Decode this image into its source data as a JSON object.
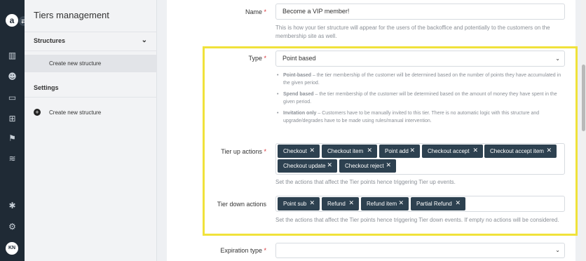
{
  "rail": {
    "logo": "a",
    "toggle": "⇄",
    "icons": [
      "chart-icon",
      "users-icon",
      "wallet-icon",
      "gift-icon",
      "flag-icon",
      "waves-icon",
      "puzzle-icon",
      "gear-icon"
    ],
    "avatar": "KN"
  },
  "sidebar": {
    "title": "Tiers management",
    "structures_label": "Structures",
    "create_sub": "Create new structure",
    "settings_label": "Settings",
    "create_action": "Create new structure"
  },
  "form": {
    "name_label": "Name",
    "name_value": "Become a VIP member!",
    "name_help": "This is how your tier structure will appear for the users of the backoffice and potentially to the customers on the membership site as well.",
    "type_label": "Type",
    "type_value": "Point based",
    "type_help": [
      {
        "term": "Point-based",
        "text": " – the tier membership of the customer will be determined based on the number of points they have accumulated in the given period."
      },
      {
        "term": "Spend based",
        "text": " – the tier membership of the customer will be determined based on the amount of money they have spent in the given period."
      },
      {
        "term": "Invitation only",
        "text": " – Customers have to be manually invited to this tier. There is no automatic logic with this structure and upgrade/degrades have to be made using rules/manual intervention."
      }
    ],
    "tier_up_label": "Tier up actions",
    "tier_up_tags": [
      "Checkout",
      "Checkout item",
      "Point add",
      "Checkout accept",
      "Checkout accept item",
      "Checkout update",
      "Checkout reject"
    ],
    "tier_up_help": "Set the actions that affect the Tier points hence triggering Tier up events.",
    "tier_down_label": "Tier down actions",
    "tier_down_tags": [
      "Point sub",
      "Refund",
      "Refund item",
      "Partial Refund"
    ],
    "tier_down_help": "Set the actions that affect the Tier points hence triggering Tier down events. If empty no actions will be considered.",
    "expiration_label": "Expiration type",
    "expiration_value": "",
    "required_mark": "*"
  },
  "colors": {
    "rail_bg": "#1f2a35",
    "tag_bg": "#2d4150",
    "highlight": "#f0e23b",
    "required": "#d9343a"
  }
}
